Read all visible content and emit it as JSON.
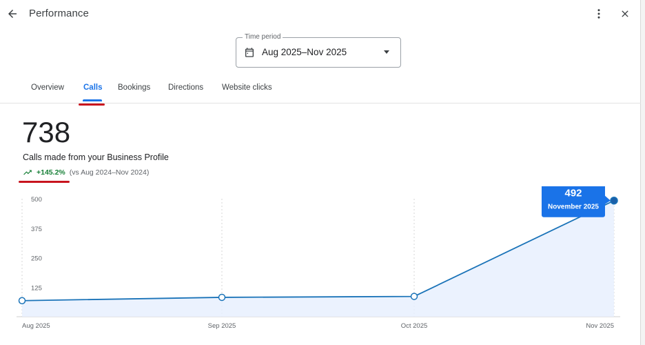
{
  "header": {
    "title": "Performance",
    "back_icon": "arrow-back-icon",
    "more_icon": "more-vert-icon",
    "close_icon": "close-icon"
  },
  "time_period": {
    "label": "Time period",
    "value": "Aug 2025–Nov 2025",
    "icon": "calendar-icon"
  },
  "tabs": [
    {
      "label": "Overview",
      "active": false
    },
    {
      "label": "Calls",
      "active": true
    },
    {
      "label": "Bookings",
      "active": false
    },
    {
      "label": "Directions",
      "active": false
    },
    {
      "label": "Website clicks",
      "active": false
    }
  ],
  "metric": {
    "value": "738",
    "caption": "Calls made from your Business Profile",
    "change": "+145.2%",
    "comparison": "(vs Aug 2024–Nov 2024)",
    "change_icon": "trending-up-icon"
  },
  "colors": {
    "accent": "#1a73e8",
    "positive": "#188038",
    "line": "#1a73b8",
    "area": "#e8f0fe",
    "annotation": "#c8141e"
  },
  "chart_data": {
    "type": "area",
    "x": [
      "Aug 2025",
      "Sep 2025",
      "Oct 2025",
      "Nov 2025"
    ],
    "series": [
      {
        "values": [
          68,
          82,
          86,
          492
        ]
      }
    ],
    "yticks": [
      125,
      250,
      375,
      500
    ],
    "ylim": [
      0,
      500
    ],
    "grid": "vertical dashed",
    "tooltip": {
      "value": "492",
      "label": "November 2025",
      "index": 3
    }
  }
}
